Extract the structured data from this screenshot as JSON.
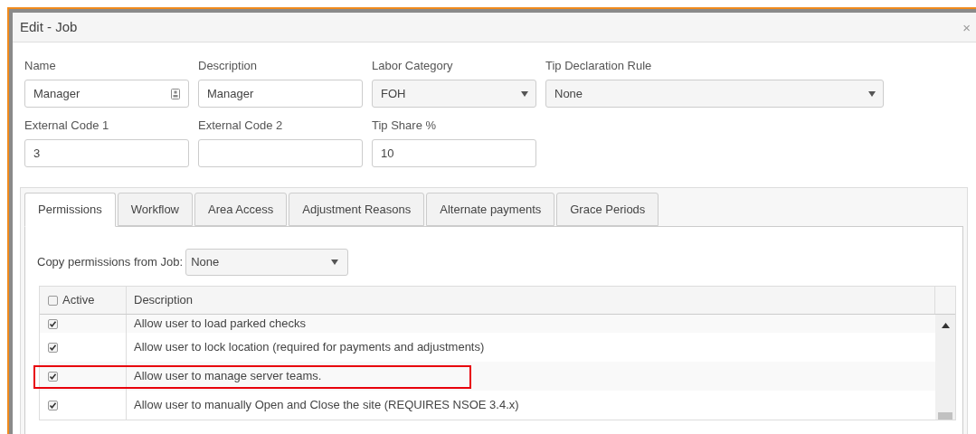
{
  "window": {
    "title": "Edit - Job",
    "close": "×"
  },
  "fields": [
    {
      "label": "Name",
      "kind": "text",
      "value": "Manager",
      "icon": true
    },
    {
      "label": "Description",
      "kind": "text",
      "value": "Manager",
      "icon": false
    },
    {
      "label": "Labor Category",
      "kind": "select",
      "value": "FOH"
    },
    {
      "label": "Tip Declaration Rule",
      "kind": "select",
      "value": "None"
    },
    {
      "label": "External Code 1",
      "kind": "text",
      "value": "3",
      "icon": false
    },
    {
      "label": "External Code 2",
      "kind": "text",
      "icon": false
    },
    {
      "label": "Tip Share %",
      "kind": "text",
      "value": "10",
      "icon": false
    }
  ],
  "tabs": [
    {
      "label": "Permissions",
      "selected": true
    },
    {
      "label": "Workflow",
      "selected": false
    },
    {
      "label": "Area Access",
      "selected": false
    },
    {
      "label": "Adjustment Reasons",
      "selected": false
    },
    {
      "label": "Alternate payments",
      "selected": false
    },
    {
      "label": "Grace Periods",
      "selected": false
    }
  ],
  "copy_permissions": {
    "label": "Copy permissions from Job:",
    "value": "None"
  },
  "table": {
    "columns": [
      "Active",
      "Description"
    ],
    "header_checked": false,
    "rows": [
      {
        "active": true,
        "description": "Allow user to load parked checks",
        "highlighted": false
      },
      {
        "active": true,
        "description": "Allow user to lock location (required for payments and adjustments)",
        "highlighted": false
      },
      {
        "active": true,
        "description": "Allow user to manage server teams.",
        "highlighted": true
      },
      {
        "active": true,
        "description": "Allow user to manually Open and Close the site (REQUIRES NSOE 3.4.x)",
        "highlighted": false
      }
    ]
  }
}
